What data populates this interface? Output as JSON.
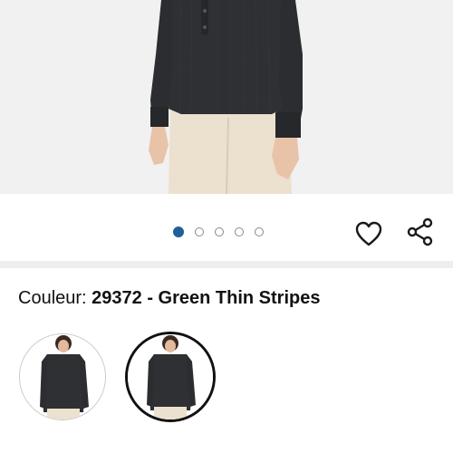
{
  "product": {
    "color_label": "Couleur: ",
    "color_value": "29372 - Green Thin Stripes",
    "color_options": [
      {
        "name": "Green Thin Stripes",
        "selected": false
      },
      {
        "name": "Green Thin Stripes",
        "selected": true
      }
    ]
  },
  "gallery": {
    "total_images": 5,
    "active_index": 0
  },
  "icons": {
    "favorite": "heart-icon",
    "share": "share-icon"
  },
  "colors": {
    "active_dot": "#1f5f9b",
    "hero_background": "#f1f1f1",
    "blouse": "#2b2d30",
    "pants": "#ece0cf"
  }
}
